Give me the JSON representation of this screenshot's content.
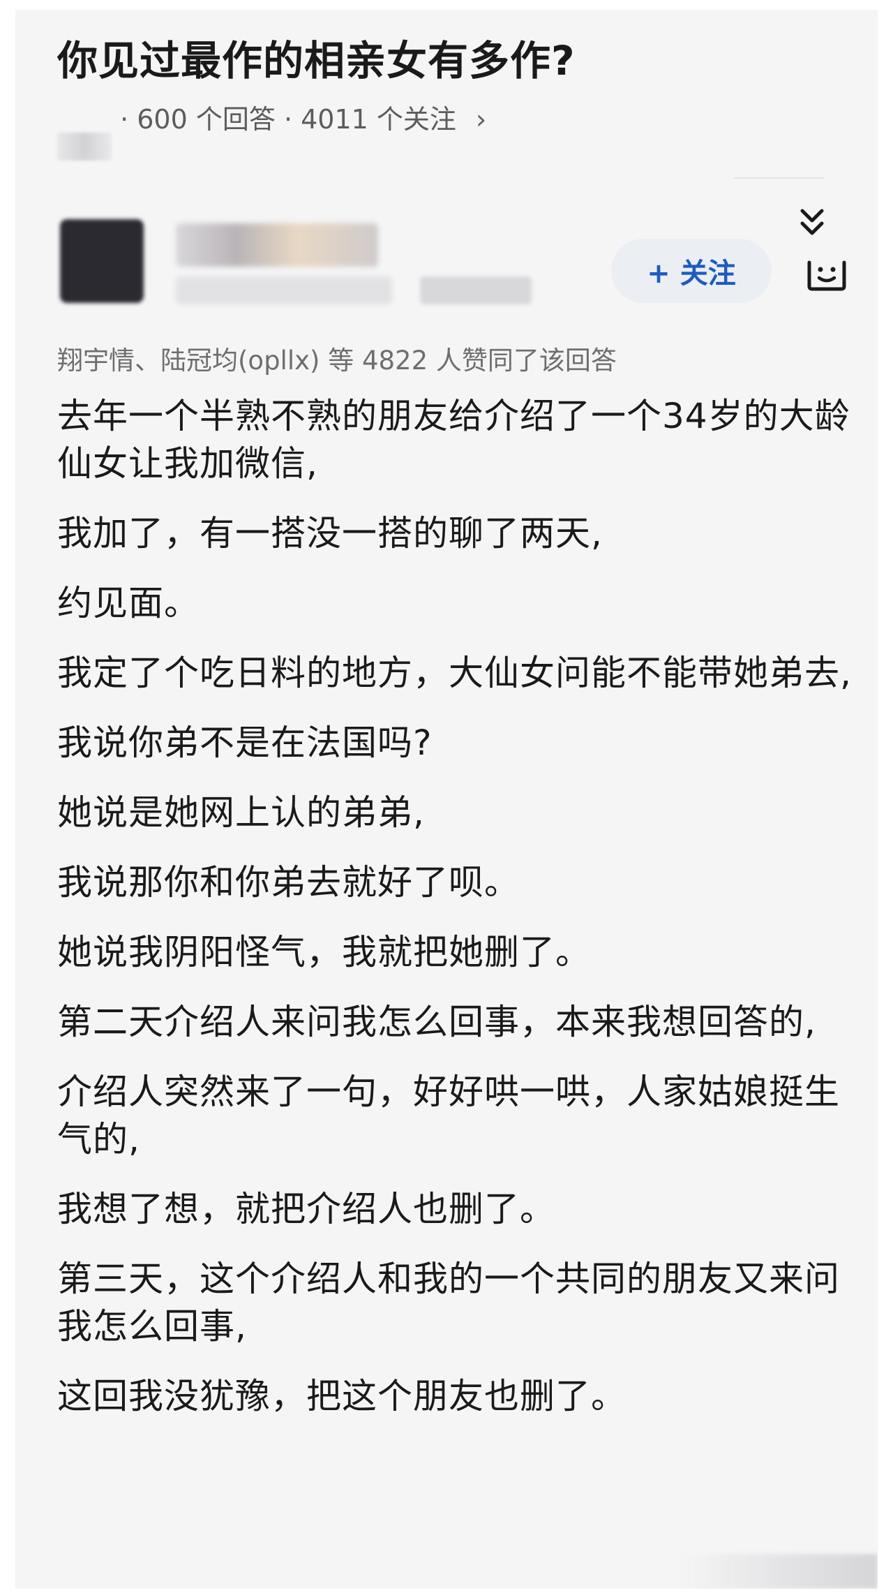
{
  "question": {
    "title": "你见过最作的相亲女有多作?",
    "source": "知乎",
    "meta": "· 600 个回答 · 4011 个关注",
    "arrow": "›"
  },
  "author": {
    "follow_label": "+ 关注"
  },
  "answer": {
    "endorsement": "翔宇情、陆冠均(opllx) 等 4822 人赞同了该回答",
    "paragraphs": [
      "去年一个半熟不熟的朋友给介绍了一个34岁的大龄仙女让我加微信,",
      "我加了，有一搭没一搭的聊了两天,",
      "约见面。",
      "我定了个吃日料的地方，大仙女问能不能带她弟去,",
      "我说你弟不是在法国吗?",
      "她说是她网上认的弟弟,",
      "我说那你和你弟去就好了呗。",
      "她说我阴阳怪气，我就把她删了。",
      "第二天介绍人来问我怎么回事，本来我想回答的,",
      "介绍人突然来了一句，好好哄一哄，人家姑娘挺生气的,",
      "我想了想，就把介绍人也删了。",
      "第三天，这个介绍人和我的一个共同的朋友又来问我怎么回事,",
      "这回我没犹豫，把这个朋友也删了。"
    ]
  },
  "icons": {
    "collapse": "double-chevron-down-icon",
    "reaction": "face-icon"
  },
  "colors": {
    "accent": "#1d5bbf",
    "background": "#f5f5f6",
    "text": "#1a1a1a",
    "muted": "#6e6e6e"
  }
}
